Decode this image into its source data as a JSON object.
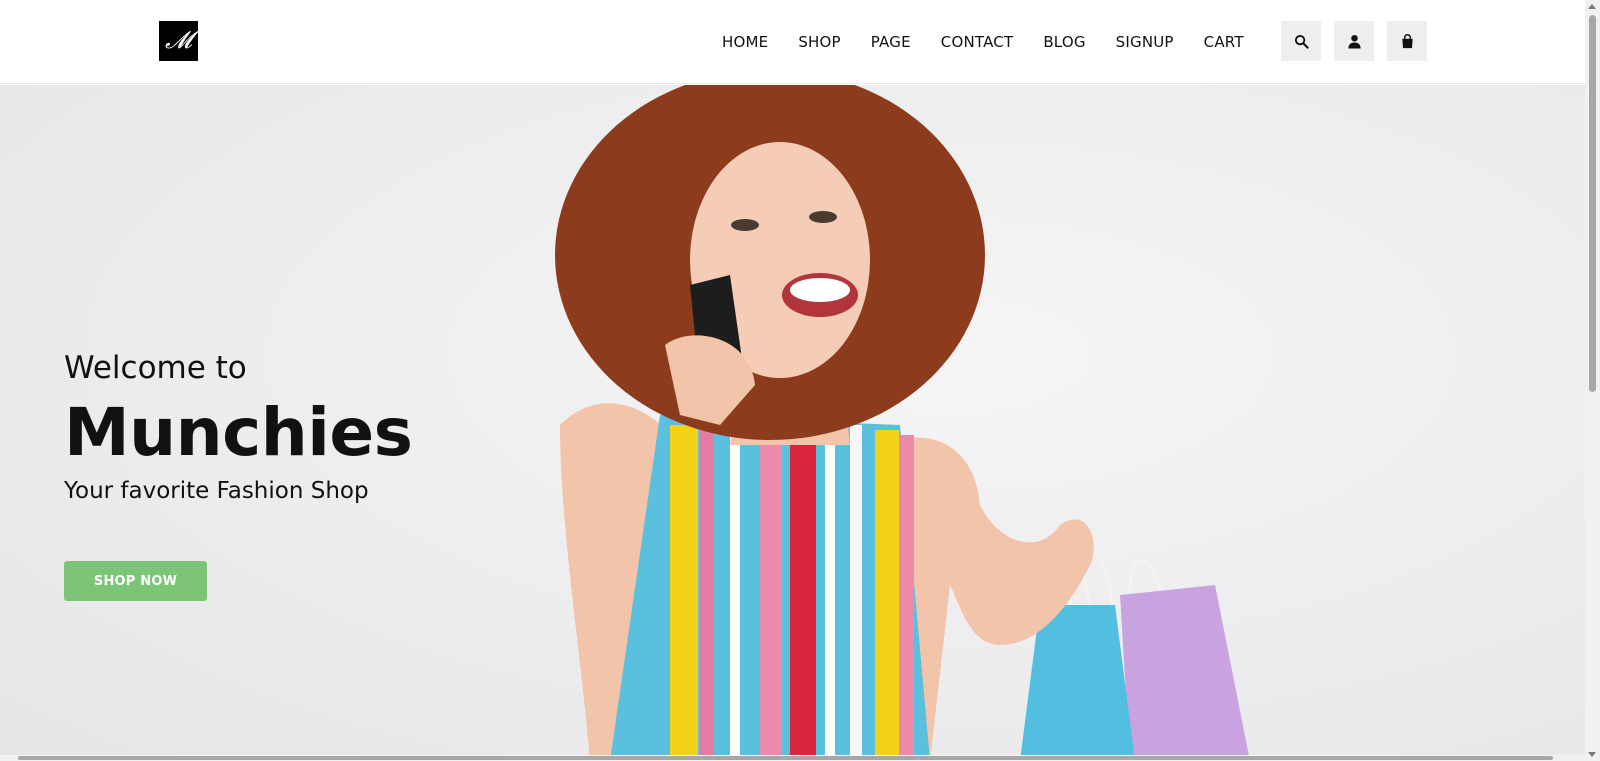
{
  "header": {
    "logo_text": "𝓜",
    "nav": [
      "HOME",
      "SHOP",
      "PAGE",
      "CONTACT",
      "BLOG",
      "SIGNUP",
      "CART"
    ],
    "icons": [
      "search-icon",
      "user-icon",
      "shopping-bag-icon"
    ]
  },
  "hero": {
    "welcome": "Welcome to",
    "brand": "Munchies",
    "tagline": "Your favorite Fashion Shop",
    "cta": "SHOP NOW"
  },
  "colors": {
    "cta": "#7cc576",
    "icon_bg": "#eeeeee",
    "hero_bg": "#ececee"
  }
}
